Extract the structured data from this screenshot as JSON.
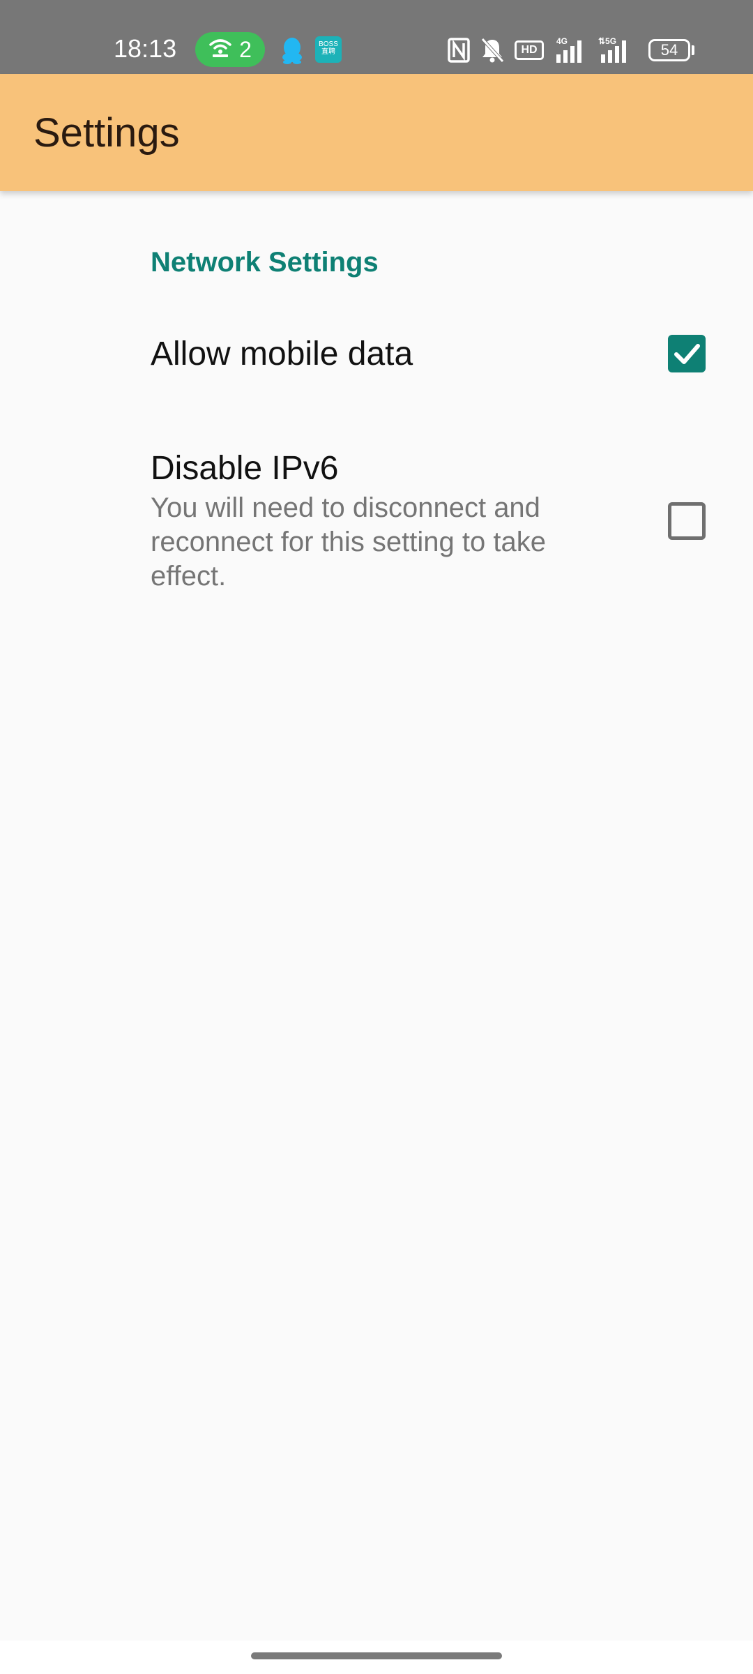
{
  "status_bar": {
    "time": "18:13",
    "hotspot_count": "2",
    "boss_label_line1": "BOSS",
    "boss_label_line2": "直聘",
    "hd_label": "HD",
    "battery": "54",
    "icons": [
      "hotspot-icon",
      "qq-icon",
      "boss-app-icon",
      "nfc-icon",
      "mute-icon",
      "hd-icon",
      "signal-4g-icon",
      "signal-5g-icon",
      "battery-icon"
    ]
  },
  "app_bar": {
    "title": "Settings",
    "background_color": "#f8c27a"
  },
  "preferences": {
    "category_title": "Network Settings",
    "accent_color": "#0e8074",
    "items": [
      {
        "title": "Allow mobile data",
        "summary": "",
        "checked": true
      },
      {
        "title": "Disable IPv6",
        "summary": "You will need to disconnect and reconnect for this setting to take effect.",
        "checked": false
      }
    ]
  }
}
